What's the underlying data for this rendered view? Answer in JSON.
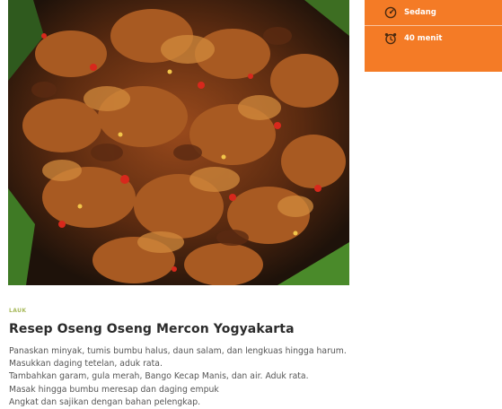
{
  "info": {
    "difficulty": "Sedang",
    "time": "40 menit",
    "difficulty_icon": "dial-icon",
    "time_icon": "alarm-clock-icon",
    "accent": "#f47b26"
  },
  "recipe": {
    "category": "LAUK",
    "title": "Resep Oseng Oseng Mercon Yogyakarta",
    "steps": [
      "Panaskan minyak, tumis bumbu halus, daun salam, dan lengkuas hingga harum.",
      "Masukkan daging tetelan, aduk rata.",
      "Tambahkan garam, gula merah, Bango Kecap Manis, dan air. Aduk rata.",
      "Masak hingga bumbu meresap dan daging empuk",
      "Angkat dan sajikan dengan bahan pelengkap."
    ]
  }
}
